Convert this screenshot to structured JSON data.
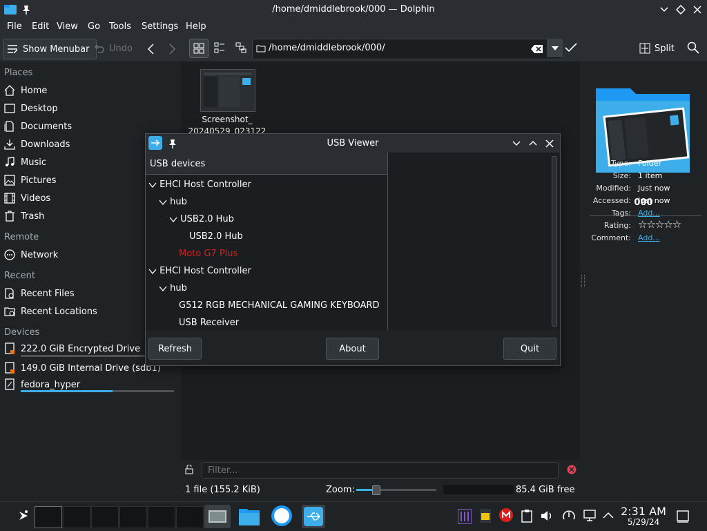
{
  "window": {
    "title": "/home/dmiddlebrook/000 — Dolphin"
  },
  "menubar": {
    "file": "File",
    "edit": "Edit",
    "view": "View",
    "go": "Go",
    "tools": "Tools",
    "settings": "Settings",
    "help": "Help"
  },
  "toolbar": {
    "show_menubar": "Show Menubar",
    "undo": "Undo",
    "address": "/home/dmiddlebrook/000/",
    "split": "Split"
  },
  "sidebar": {
    "places_header": "Places",
    "places": [
      {
        "label": "Home",
        "icon": "home-icon"
      },
      {
        "label": "Desktop",
        "icon": "desktop-icon"
      },
      {
        "label": "Documents",
        "icon": "documents-icon"
      },
      {
        "label": "Downloads",
        "icon": "downloads-icon"
      },
      {
        "label": "Music",
        "icon": "music-icon"
      },
      {
        "label": "Pictures",
        "icon": "pictures-icon"
      },
      {
        "label": "Videos",
        "icon": "videos-icon"
      },
      {
        "label": "Trash",
        "icon": "trash-icon"
      }
    ],
    "remote_header": "Remote",
    "network": "Network",
    "recent_header": "Recent",
    "recent_files": "Recent Files",
    "recent_locations": "Recent Locations",
    "devices_header": "Devices",
    "devices": [
      {
        "label": "222.0 GiB Encrypted Drive",
        "usage": 0.0
      },
      {
        "label": "149.0 GiB Internal Drive (sdb1)",
        "usage": 0.0
      },
      {
        "label": "fedora_hyper",
        "usage": 0.6
      }
    ]
  },
  "files": {
    "item_name_1": "Screenshot_",
    "item_name_2": "20240529_023122"
  },
  "info": {
    "name": "000",
    "type_label": "Type:",
    "type": "Folder",
    "size_label": "Size:",
    "size": "1 item",
    "modified_label": "Modified:",
    "modified": "Just now",
    "accessed_label": "Accessed:",
    "accessed": "Just now",
    "tags_label": "Tags:",
    "tags_link": "Add...",
    "rating_label": "Rating:",
    "rating": 0,
    "comment_label": "Comment:",
    "comment_link": "Add..."
  },
  "filter": {
    "placeholder": "Filter..."
  },
  "status": {
    "files": "1 file (155.2 KiB)",
    "zoom_label": "Zoom:",
    "zoom_level": 0.25,
    "free": "85.4 GiB free"
  },
  "usb_dialog": {
    "title": "USB Viewer",
    "header": "USB devices",
    "tree": [
      {
        "label": "EHCI Host Controller",
        "level": 0,
        "expanded": true
      },
      {
        "label": "hub",
        "level": 1,
        "expanded": true
      },
      {
        "label": "USB2.0 Hub",
        "level": 2,
        "expanded": true
      },
      {
        "label": "USB2.0 Hub",
        "level": 3
      },
      {
        "label": "Moto G7 Plus",
        "level": 2,
        "highlight": true
      },
      {
        "label": "EHCI Host Controller",
        "level": 0,
        "expanded": true
      },
      {
        "label": "hub",
        "level": 1,
        "expanded": true
      },
      {
        "label": "G512 RGB MECHANICAL GAMING KEYBOARD",
        "level": 2
      },
      {
        "label": "USB Receiver",
        "level": 2
      }
    ],
    "refresh": "Refresh",
    "about": "About",
    "quit": "Quit",
    "highlight_color": "#da1f1f"
  },
  "taskbar": {
    "time": "2:31 AM",
    "date": "5/29/24"
  },
  "colors": {
    "accent": "#3daee9",
    "warning": "#f67400",
    "error": "#da4453"
  }
}
